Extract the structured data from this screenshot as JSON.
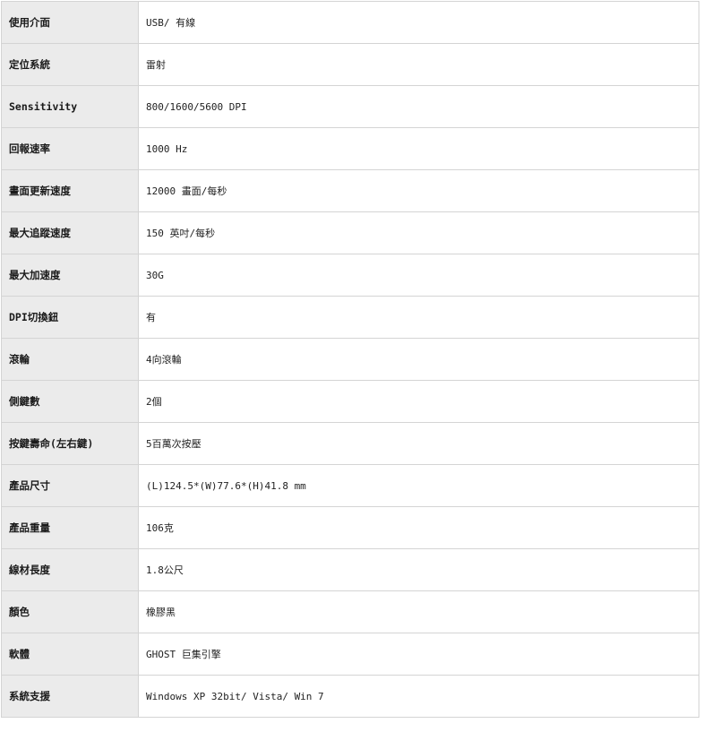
{
  "specs": [
    {
      "label": "使用介面",
      "value": "USB/ 有線"
    },
    {
      "label": "定位系統",
      "value": "雷射"
    },
    {
      "label": "Sensitivity",
      "value": "800/1600/5600 DPI"
    },
    {
      "label": "回報速率",
      "value": "1000 Hz"
    },
    {
      "label": "畫面更新速度",
      "value": "12000 畫面/每秒"
    },
    {
      "label": "最大追蹤速度",
      "value": "150 英吋/每秒"
    },
    {
      "label": "最大加速度",
      "value": "30G"
    },
    {
      "label": "DPI切換鈕",
      "value": "有"
    },
    {
      "label": "滾輪",
      "value": "4向滾輪"
    },
    {
      "label": "側鍵數",
      "value": "2個"
    },
    {
      "label": "按鍵壽命(左右鍵)",
      "value": "5百萬次按壓"
    },
    {
      "label": "產品尺寸",
      "value": "(L)124.5*(W)77.6*(H)41.8 mm"
    },
    {
      "label": "產品重量",
      "value": "106克"
    },
    {
      "label": "線材長度",
      "value": "1.8公尺"
    },
    {
      "label": "顏色",
      "value": "橡膠黑"
    },
    {
      "label": "軟體",
      "value": "GHOST 巨集引擎"
    },
    {
      "label": "系統支援",
      "value": "Windows XP 32bit/ Vista/ Win 7"
    }
  ]
}
